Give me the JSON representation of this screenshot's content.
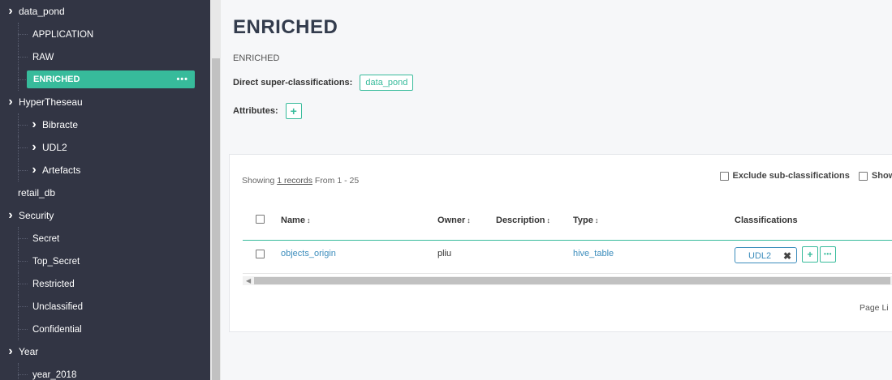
{
  "sidebar": {
    "items": [
      {
        "label": "data_pond",
        "level": 0,
        "chevron": true
      },
      {
        "label": "APPLICATION",
        "level": 1,
        "chevron": false
      },
      {
        "label": "RAW",
        "level": 1,
        "chevron": false
      },
      {
        "label": "ENRICHED",
        "level": 1,
        "chevron": false,
        "active": true
      },
      {
        "label": "HyperTheseau",
        "level": 0,
        "chevron": true
      },
      {
        "label": "Bibracte",
        "level": 1,
        "chevron": true
      },
      {
        "label": "UDL2",
        "level": 1,
        "chevron": true
      },
      {
        "label": "Artefacts",
        "level": 1,
        "chevron": true
      },
      {
        "label": "retail_db",
        "level": 0,
        "chevron": false
      },
      {
        "label": "Security",
        "level": 0,
        "chevron": true
      },
      {
        "label": "Secret",
        "level": 1,
        "chevron": false
      },
      {
        "label": "Top_Secret",
        "level": 1,
        "chevron": false
      },
      {
        "label": "Restricted",
        "level": 1,
        "chevron": false
      },
      {
        "label": "Unclassified",
        "level": 1,
        "chevron": false
      },
      {
        "label": "Confidential",
        "level": 1,
        "chevron": false
      },
      {
        "label": "Year",
        "level": 0,
        "chevron": true
      },
      {
        "label": "year_2018",
        "level": 1,
        "chevron": false
      }
    ],
    "active_more": "•••"
  },
  "header": {
    "title": "ENRICHED",
    "subtitle": "ENRICHED",
    "super_label": "Direct super-classifications:",
    "super_tag": "data_pond",
    "attributes_label": "Attributes:",
    "plus": "+"
  },
  "panel": {
    "showing_prefix": "Showing ",
    "showing_link": "1 records",
    "showing_suffix": " From 1 - 25",
    "exclude_label": "Exclude sub-classifications",
    "show_label": "Show h",
    "columns": {
      "name": "Name",
      "owner": "Owner",
      "description": "Description",
      "type": "Type",
      "classifications": "Classifications"
    },
    "sort_icon": "↕",
    "rows": [
      {
        "name": "objects_origin",
        "owner": "pliu",
        "description": "",
        "type": "hive_table",
        "classification": "UDL2"
      }
    ],
    "remove_icon": "✖",
    "more": "•••",
    "page_limit": "Page Li",
    "scroll_left": "◀"
  },
  "colors": {
    "sidebar_bg": "#323544",
    "accent": "#37bb9b",
    "link": "#3c8dbc"
  }
}
